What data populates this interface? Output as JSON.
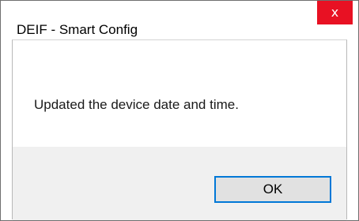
{
  "window": {
    "title": "DEIF - Smart Config",
    "close_glyph": "x",
    "close_icon": "close-icon",
    "close_color": "#e81123"
  },
  "dialog": {
    "message": "Updated the device date and time.",
    "ok_label": "OK",
    "accent": "#0078d7"
  }
}
